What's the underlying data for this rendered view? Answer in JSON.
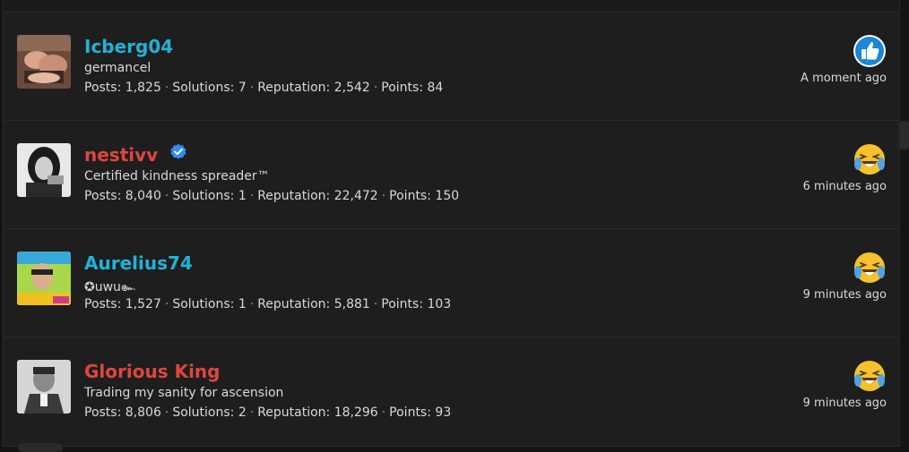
{
  "members": [
    {
      "username": "Icberg04",
      "name_color": "#1fb3d8",
      "verified": false,
      "title": "germancel",
      "stats": {
        "posts_label": "Posts:",
        "posts": "1,825",
        "solutions_label": "Solutions:",
        "solutions": "7",
        "reputation_label": "Reputation:",
        "reputation": "2,542",
        "points_label": "Points:",
        "points": "84"
      },
      "reaction_icon": "like-icon",
      "time": "A moment ago"
    },
    {
      "username": "nestivv",
      "name_color": "#e0463d",
      "verified": true,
      "title": "Certified kindness spreader™",
      "stats": {
        "posts_label": "Posts:",
        "posts": "8,040",
        "solutions_label": "Solutions:",
        "solutions": "1",
        "reputation_label": "Reputation:",
        "reputation": "22,472",
        "points_label": "Points:",
        "points": "150"
      },
      "reaction_icon": "laughing-crying-emoji-icon",
      "time": "6 minutes ago"
    },
    {
      "username": "Aurelius74",
      "name_color": "#1fb3d8",
      "verified": false,
      "title": "✪uwu๛",
      "stats": {
        "posts_label": "Posts:",
        "posts": "1,527",
        "solutions_label": "Solutions:",
        "solutions": "1",
        "reputation_label": "Reputation:",
        "reputation": "5,881",
        "points_label": "Points:",
        "points": "103"
      },
      "reaction_icon": "laughing-crying-emoji-icon",
      "time": "9 minutes ago"
    },
    {
      "username": "Glorious King",
      "name_color": "#e0463d",
      "verified": false,
      "title": "Trading my sanity for ascension",
      "stats": {
        "posts_label": "Posts:",
        "posts": "8,806",
        "solutions_label": "Solutions:",
        "solutions": "2",
        "reputation_label": "Reputation:",
        "reputation": "18,296",
        "points_label": "Points:",
        "points": "93"
      },
      "reaction_icon": "laughing-crying-emoji-icon",
      "time": "9 minutes ago"
    }
  ],
  "colors": {
    "background": "#1e1e1e",
    "text": "#d9d9d9",
    "separator": "#9a9a9a",
    "verified_badge": "#2f8ff0",
    "like_blue": "#1a86d9",
    "emoji_yellow": "#f5c22b"
  }
}
